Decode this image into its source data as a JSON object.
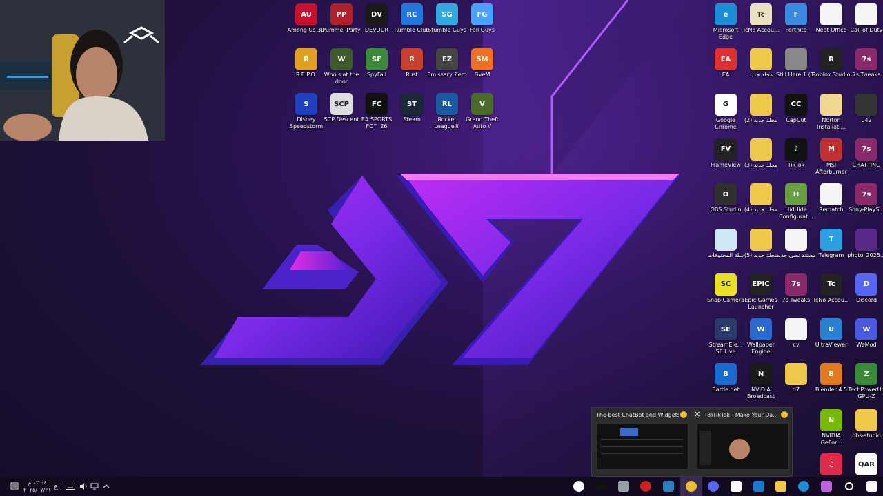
{
  "desktop": {
    "icons": [
      {
        "label": "Among Us 3D",
        "color": "#c8102e",
        "glyph": "AU"
      },
      {
        "label": "Pummel Party",
        "color": "#b0202a",
        "glyph": "PP"
      },
      {
        "label": "DEVOUR",
        "color": "#1a1a1a",
        "glyph": "DV"
      },
      {
        "label": "Rumble Club",
        "color": "#2277dd",
        "glyph": "RC"
      },
      {
        "label": "Stumble Guys",
        "color": "#2fa9e0",
        "glyph": "SG"
      },
      {
        "label": "Fall Guys",
        "color": "#4aa0ff",
        "glyph": "FG"
      },
      {
        "label": "R.E.P.O.",
        "color": "#e0a020",
        "glyph": "R"
      },
      {
        "label": "Who's at the door",
        "color": "#3d5a2a",
        "glyph": "W"
      },
      {
        "label": "SpyFall",
        "color": "#3a8a3a",
        "glyph": "SF"
      },
      {
        "label": "Rust",
        "color": "#c8402a",
        "glyph": "R"
      },
      {
        "label": "Emissary Zero",
        "color": "#444444",
        "glyph": "EZ"
      },
      {
        "label": "FiveM",
        "color": "#f07020",
        "glyph": "5M"
      },
      {
        "label": "Disney Speedstorm",
        "color": "#2040c0",
        "glyph": "S"
      },
      {
        "label": "SCP Descent",
        "color": "#dddddd",
        "glyph": "SCP"
      },
      {
        "label": "EA SPORTS FC™ 26",
        "color": "#111111",
        "glyph": "FC"
      },
      {
        "label": "Steam",
        "color": "#1b2838",
        "glyph": "ST"
      },
      {
        "label": "Rocket League®",
        "color": "#1a5aa0",
        "glyph": "RL"
      },
      {
        "label": "Grand Theft Auto V",
        "color": "#4a6a2a",
        "glyph": "V"
      },
      {
        "label": "Microsoft Edge",
        "color": "#1a8fd8",
        "glyph": "e"
      },
      {
        "label": "TcNo Accou...",
        "color": "#e8e0c0",
        "glyph": "Tc"
      },
      {
        "label": "Fortnite",
        "color": "#3a8ae0",
        "glyph": "F"
      },
      {
        "label": "Neat Office",
        "color": "#f4f4f4",
        "glyph": ""
      },
      {
        "label": "Call of Duty",
        "color": "#f4f4f4",
        "glyph": ""
      },
      {
        "label": "EA",
        "color": "#e03030",
        "glyph": "EA"
      },
      {
        "label": "مجلد جديد",
        "color": "#f0c84a",
        "glyph": ""
      },
      {
        "label": "Still Here 1 (1)",
        "color": "#888888",
        "glyph": ""
      },
      {
        "label": "Roblox Studio",
        "color": "#222222",
        "glyph": "R"
      },
      {
        "label": "7s Tweaks",
        "color": "#8a2a6a",
        "glyph": "7s"
      },
      {
        "label": "Google Chrome",
        "color": "#ffffff",
        "glyph": "G"
      },
      {
        "label": "مجلد جديد (2)",
        "color": "#f0c84a",
        "glyph": ""
      },
      {
        "label": "CapCut",
        "color": "#111111",
        "glyph": "CC"
      },
      {
        "label": "Norton Installati...",
        "color": "#f0d890",
        "glyph": ""
      },
      {
        "label": "042",
        "color": "#333333",
        "glyph": ""
      },
      {
        "label": "FrameView",
        "color": "#222222",
        "glyph": "FV"
      },
      {
        "label": "مجلد جديد (3)",
        "color": "#f0c84a",
        "glyph": ""
      },
      {
        "label": "TikTok",
        "color": "#111111",
        "glyph": "♪"
      },
      {
        "label": "MSI Afterburner",
        "color": "#c03030",
        "glyph": "M"
      },
      {
        "label": "CHATTING",
        "color": "#8a2a6a",
        "glyph": "7s"
      },
      {
        "label": "OBS Studio",
        "color": "#303030",
        "glyph": "O"
      },
      {
        "label": "مجلد جديد (4)",
        "color": "#f0c84a",
        "glyph": ""
      },
      {
        "label": "HidHide Configurat...",
        "color": "#6aa040",
        "glyph": "H"
      },
      {
        "label": "Rematch",
        "color": "#f4f4f4",
        "glyph": ""
      },
      {
        "label": "Sony-PlayS...",
        "color": "#8a2a6a",
        "glyph": "7s"
      },
      {
        "label": "سلة المحذوفات",
        "color": "#cfe8f8",
        "glyph": ""
      },
      {
        "label": "مجلد جديد (5)",
        "color": "#f0c84a",
        "glyph": ""
      },
      {
        "label": "مستند نصي جديد",
        "color": "#f4f4f4",
        "glyph": ""
      },
      {
        "label": "Telegram",
        "color": "#2aa0e0",
        "glyph": "T"
      },
      {
        "label": "photo_2025...",
        "color": "#5a2a8a",
        "glyph": ""
      },
      {
        "label": "Snap Camera",
        "color": "#e8e020",
        "glyph": "SC"
      },
      {
        "label": "Epic Games Launcher",
        "color": "#222222",
        "glyph": "EPIC"
      },
      {
        "label": "7s Tweaks",
        "color": "#8a2a6a",
        "glyph": "7s"
      },
      {
        "label": "TcNo Accou...",
        "color": "#222222",
        "glyph": "Tc"
      },
      {
        "label": "Discord",
        "color": "#5865f2",
        "glyph": "D"
      },
      {
        "label": "StreamEle... SE.Live",
        "color": "#2a3a6a",
        "glyph": "SE"
      },
      {
        "label": "Wallpaper Engine",
        "color": "#2a6ad0",
        "glyph": "W"
      },
      {
        "label": "cv",
        "color": "#f4f4f4",
        "glyph": ""
      },
      {
        "label": "UltraViewer",
        "color": "#2a80d0",
        "glyph": "U"
      },
      {
        "label": "WeMod",
        "color": "#4a5ae0",
        "glyph": "W"
      },
      {
        "label": "Battle.net",
        "color": "#1a6ad0",
        "glyph": "B"
      },
      {
        "label": "NVIDIA Broadcast",
        "color": "#1a1a1a",
        "glyph": "N"
      },
      {
        "label": "d7",
        "color": "#f0c84a",
        "glyph": ""
      },
      {
        "label": "Blender 4.5",
        "color": "#e07a20",
        "glyph": "B"
      },
      {
        "label": "TechPowerUp GPU-Z",
        "color": "#3a8a3a",
        "glyph": "Z"
      },
      {
        "label": "NVIDIA GeFor...",
        "color": "#76b900",
        "glyph": "N"
      },
      {
        "label": "obs-studio",
        "color": "#f0c84a",
        "glyph": ""
      },
      {
        "label": "",
        "color": "#e02a4a",
        "glyph": "♫"
      },
      {
        "label": "",
        "color": "#ffffff",
        "glyph": "QAR"
      }
    ]
  },
  "taskbar": {
    "time": "١٢:٠٤ م",
    "date": "٢٠٢٥/٠٧/٢١",
    "lang": "ع",
    "apps": [
      {
        "name": "app-obs",
        "color": "#ffffff"
      },
      {
        "name": "app-tiktok",
        "color": "#111111"
      },
      {
        "name": "app-files",
        "color": "#9aa0aa"
      },
      {
        "name": "app-obs-recording",
        "color": "#d02020"
      },
      {
        "name": "app-steam",
        "color": "#2a80c0"
      },
      {
        "name": "app-chrome",
        "color": "#e8c030"
      },
      {
        "name": "app-discord",
        "color": "#5865f2"
      },
      {
        "name": "app-store",
        "color": "#ffffff"
      },
      {
        "name": "app-outlook",
        "color": "#1a7ad0"
      },
      {
        "name": "app-explorer",
        "color": "#f0c84a"
      },
      {
        "name": "app-edge",
        "color": "#1a8fd8"
      },
      {
        "name": "app-copilot",
        "color": "#c060e0"
      },
      {
        "name": "app-search",
        "color": "#ffffff"
      },
      {
        "name": "app-start",
        "color": "#ffffff"
      }
    ]
  },
  "preview": {
    "items": [
      {
        "title": "The best ChatBot and Widgets f..."
      },
      {
        "title": "(8)TikTok - Make Your Da..."
      }
    ]
  }
}
